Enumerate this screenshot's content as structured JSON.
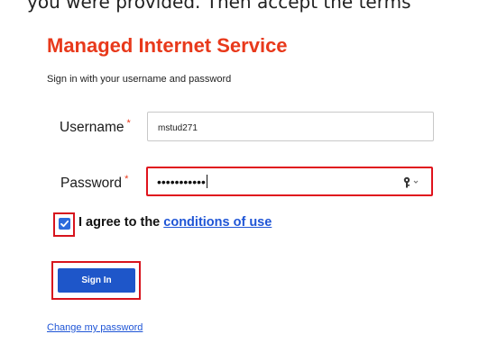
{
  "caption": "you were provided. Then accept the terms",
  "form": {
    "title": "Managed Internet Service",
    "subtitle": "Sign in with your username and password",
    "username_label": "Username",
    "username_value": "mstud271",
    "password_label": "Password",
    "password_masked": "•••••••••••",
    "required_mark": "*",
    "agree_prefix": "I agree to the",
    "conditions_link": "conditions of use",
    "agree_checked": true,
    "signin_label": "Sign In",
    "change_password_link": "Change my password"
  },
  "icons": {
    "password_field_icon": "key-icon",
    "checkbox_icon": "checkmark-icon"
  },
  "colors": {
    "title": "#e8391b",
    "link": "#1f55d6",
    "button": "#1e56c9",
    "highlight": "#d7141d"
  }
}
